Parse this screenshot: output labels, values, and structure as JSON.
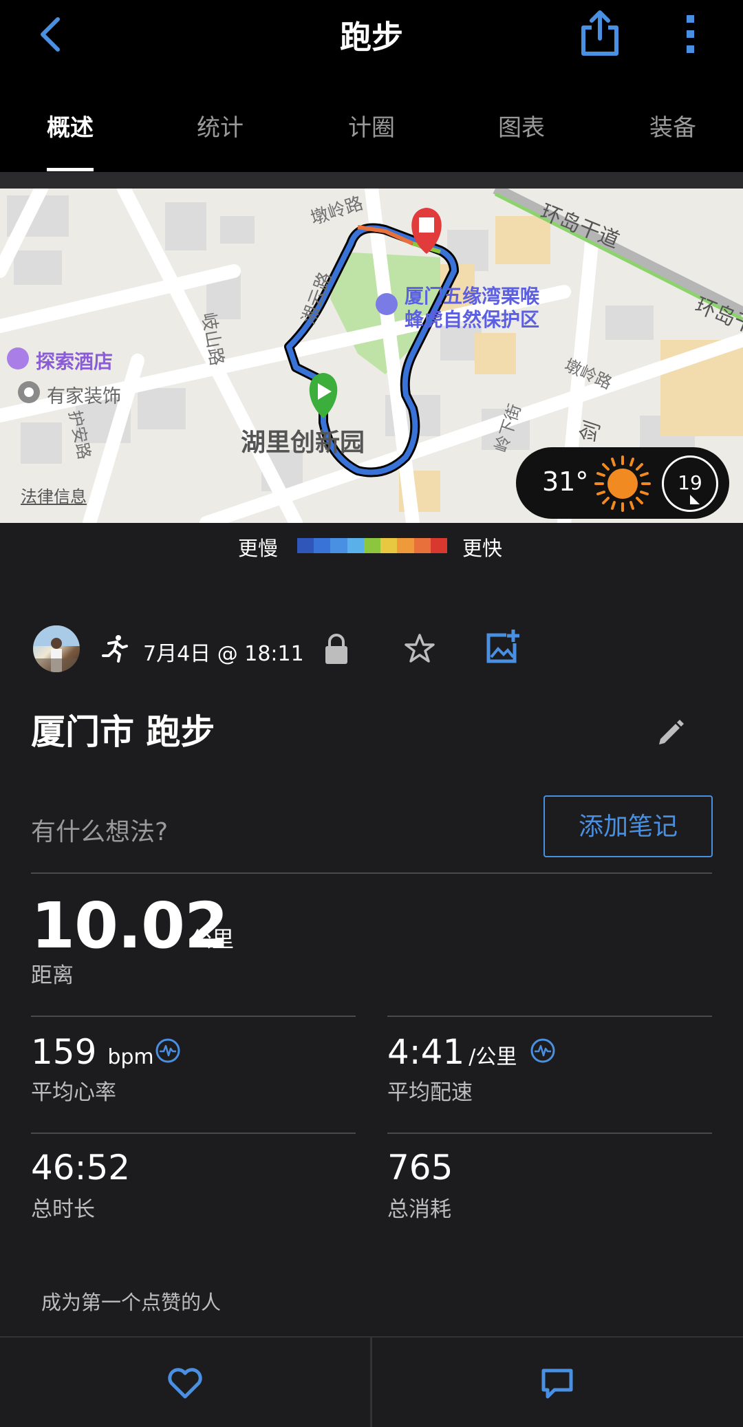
{
  "header": {
    "title": "跑步",
    "back_icon": "chevron-left-icon",
    "share_icon": "share-icon",
    "more_icon": "more-vertical-icon"
  },
  "tabs": [
    "概述",
    "统计",
    "计圈",
    "图表",
    "装备"
  ],
  "active_tab": "概述",
  "map": {
    "labels": {
      "road_dunling_1": "墩岭路",
      "road_huandao_1": "环岛干道",
      "road_huandao_2": "环岛干",
      "road_qishan": "岐山路",
      "road_jian": "剑",
      "road_xiangzhan": "湘云路",
      "road_dunling_2": "墩岭路",
      "road_hu_an": "护安路",
      "road_yun": "云",
      "road_bottom": "路",
      "road_lingxia": "岭下街",
      "road_gang": "剑"
    },
    "poi_reserve": "厦门五缘湾栗喉蜂虎自然保护区",
    "poi_hotel": "探索酒店",
    "poi_deco": "有家装饰",
    "park": "湖里创新园",
    "legal": "法律信息"
  },
  "weather": {
    "temperature": "31°",
    "wind": "19"
  },
  "legend": {
    "slow": "更慢",
    "fast": "更快",
    "colors": [
      "#2f56b8",
      "#3a73d8",
      "#4a90e2",
      "#5ab0e8",
      "#8cc63f",
      "#e8c840",
      "#ef9a3a",
      "#e8703a",
      "#d9382f"
    ]
  },
  "activity": {
    "date": "7月4日 @ 18:11",
    "title": "厦门市 跑步",
    "thoughts_placeholder": "有什么想法?",
    "add_note": "添加笔记"
  },
  "stats": {
    "distance": {
      "value": "10.02",
      "unit": "公里",
      "label": "距离"
    },
    "heart_rate": {
      "value": "159",
      "unit": "bpm",
      "label": "平均心率"
    },
    "pace": {
      "value": "4:41",
      "unit": "/公里",
      "label": "平均配速"
    },
    "duration": {
      "value": "46:52",
      "label": "总时长"
    },
    "calories": {
      "value": "765",
      "label": "总消耗"
    }
  },
  "likes_text": "成为第一个点赞的人",
  "accent_color": "#4a90e2"
}
